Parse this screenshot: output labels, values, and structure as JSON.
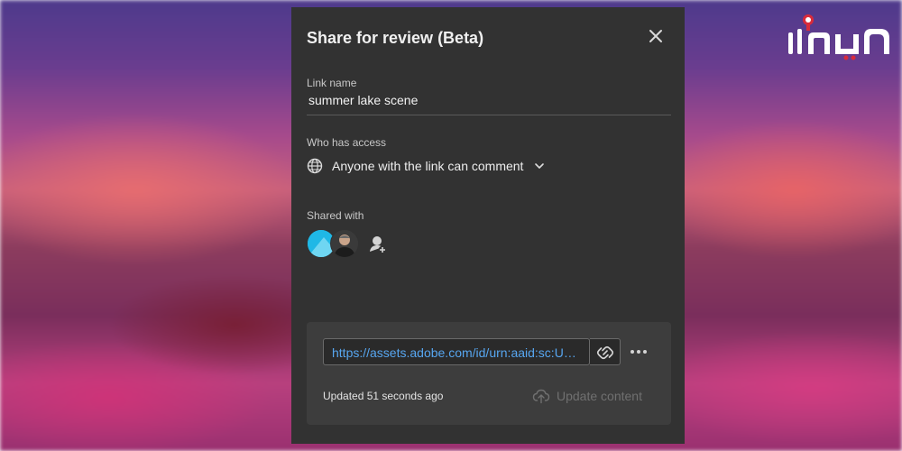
{
  "dialog": {
    "title": "Share for review (Beta)",
    "link_name_label": "Link name",
    "link_name_value": "summer lake scene",
    "access_label": "Who has access",
    "access_value": "Anyone with the link can comment",
    "shared_with_label": "Shared with",
    "url": "https://assets.adobe.com/id/urn:aaid:sc:US:...",
    "updated_text": "Updated 51 seconds ago",
    "update_button_label": "Update content"
  },
  "icons": {
    "close": "close-icon",
    "access": "globe-icon",
    "dropdown": "chevron-down-icon",
    "add_user": "add-user-icon",
    "copy_link": "link-icon",
    "more": "more-icon",
    "upload": "cloud-upload-icon"
  },
  "colors": {
    "panel": "#323232",
    "link": "#57a6f0",
    "avatar_accent": "#1fb8e6",
    "logo_red": "#d92b3a"
  }
}
